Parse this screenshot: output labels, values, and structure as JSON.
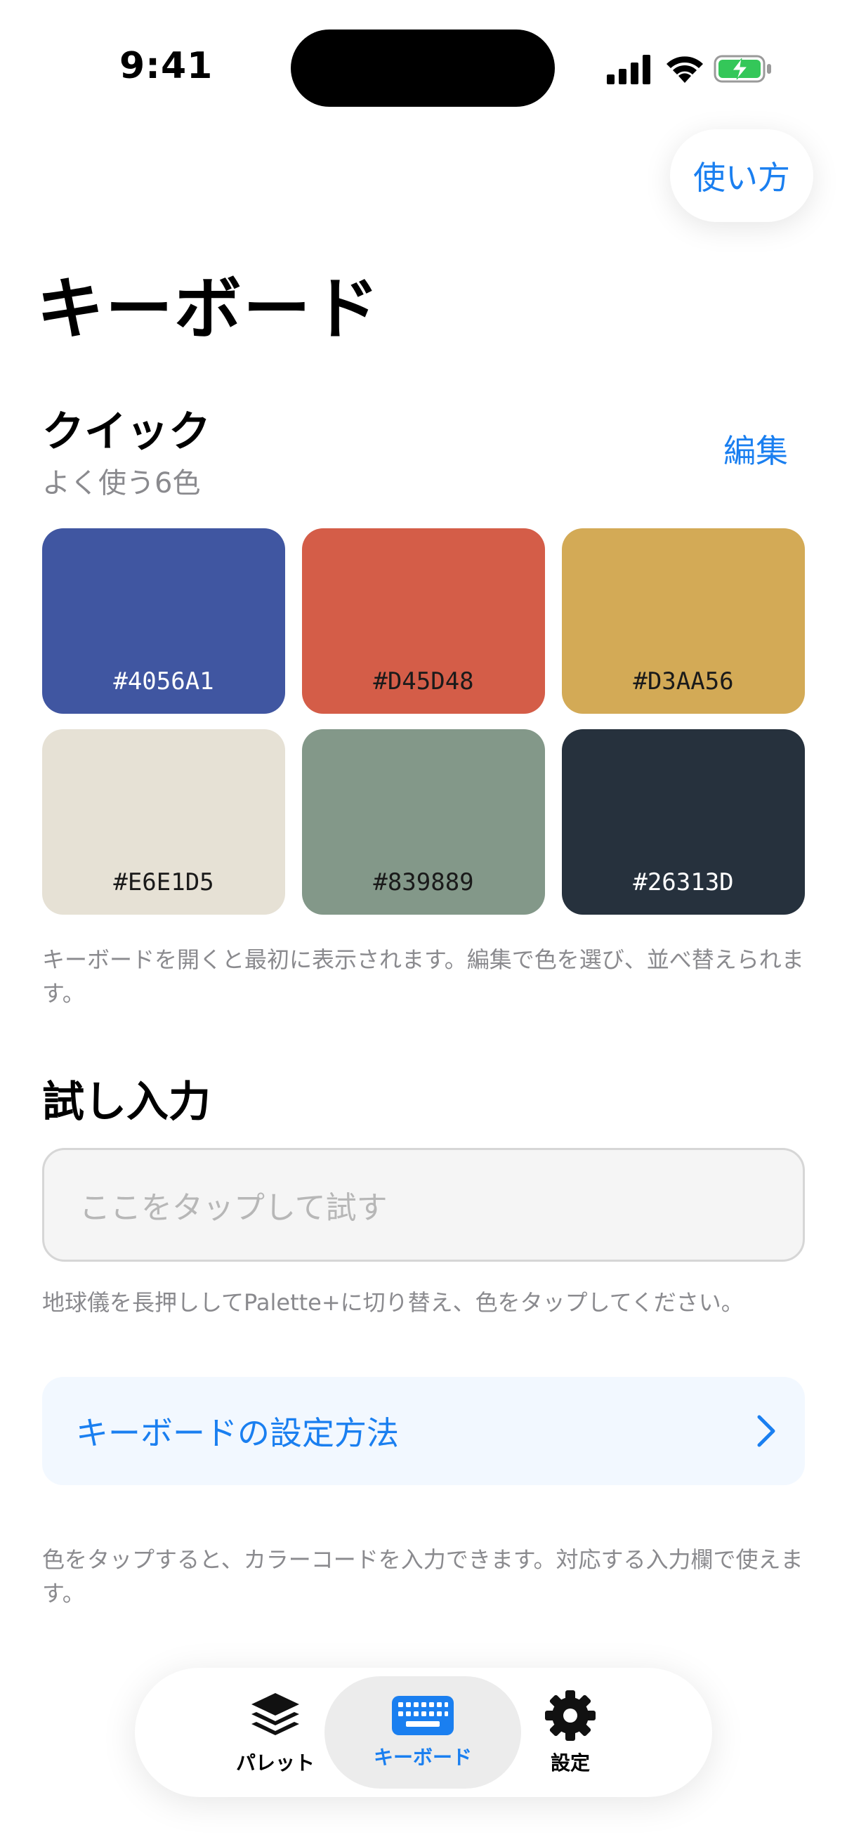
{
  "status_bar": {
    "time": "9:41"
  },
  "header": {
    "help_label": "使い方",
    "title": "キーボード"
  },
  "quick": {
    "title": "クイック",
    "subtitle": "よく使う6色",
    "edit_label": "編集",
    "swatches": [
      {
        "hex": "#4056A1",
        "label": "#4056A1",
        "text_color": "#ffffff"
      },
      {
        "hex": "#D45D48",
        "label": "#D45D48",
        "text_color": "#1a1a1a"
      },
      {
        "hex": "#D3AA56",
        "label": "#D3AA56",
        "text_color": "#1a1a1a"
      },
      {
        "hex": "#E6E1D5",
        "label": "#E6E1D5",
        "text_color": "#1a1a1a"
      },
      {
        "hex": "#839889",
        "label": "#839889",
        "text_color": "#1a1a1a"
      },
      {
        "hex": "#26313D",
        "label": "#26313D",
        "text_color": "#ffffff"
      }
    ],
    "note": "キーボードを開くと最初に表示されます。編集で色を選び、並べ替えられます。"
  },
  "try_input": {
    "title": "試し入力",
    "placeholder": "ここをタップして試す",
    "hint": "地球儀を長押ししてPalette+に切り替え、色をタップしてください。"
  },
  "setup": {
    "label": "キーボードの設定方法",
    "chevron_icon": "chevron-right-icon"
  },
  "footer_note": "色をタップすると、カラーコードを入力できます。対応する入力欄で使えます。",
  "tabbar": {
    "tabs": [
      {
        "label": "パレット",
        "icon": "layers-icon",
        "active": false
      },
      {
        "label": "キーボード",
        "icon": "keyboard-icon",
        "active": true
      },
      {
        "label": "設定",
        "icon": "gear-icon",
        "active": false
      }
    ]
  },
  "colors": {
    "accent": "#1a7ff0",
    "secondary_text": "#8a8a8e",
    "battery_fill": "#34c759"
  }
}
